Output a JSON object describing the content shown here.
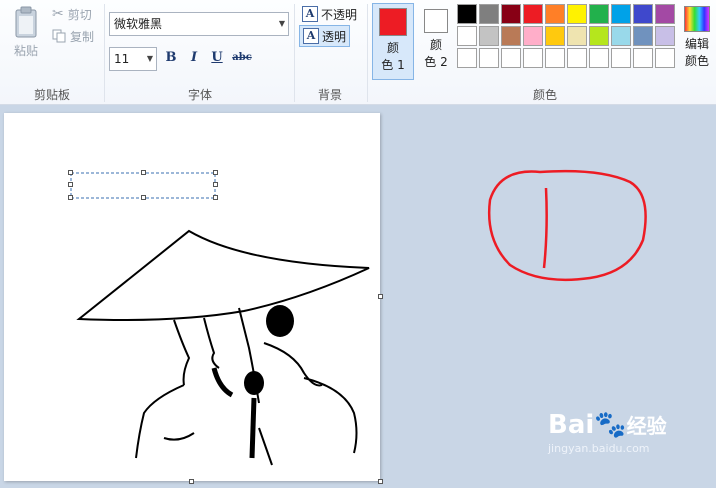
{
  "clipboard": {
    "paste_label": "粘贴",
    "cut_label": "剪切",
    "copy_label": "复制",
    "group_label": "剪贴板"
  },
  "font": {
    "family_value": "微软雅黑",
    "size_value": "11",
    "bold_label": "B",
    "italic_label": "I",
    "underline_label": "U",
    "strike_label": "abc",
    "group_label": "字体"
  },
  "background": {
    "opaque_label": "不透明",
    "transparent_label": "透明",
    "group_label": "背景",
    "icon_letter": "A"
  },
  "colors": {
    "color1_label_line1": "颜",
    "color1_label_line2": "色 1",
    "color2_label_line1": "颜",
    "color2_label_line2": "色 2",
    "color1_value": "#ed1c24",
    "color2_value": "#ffffff",
    "edit_label_line1": "编辑",
    "edit_label_line2": "颜色",
    "group_label": "颜色",
    "palette": [
      "#000000",
      "#7f7f7f",
      "#880015",
      "#ed1c24",
      "#ff7f27",
      "#fff200",
      "#22b14c",
      "#00a2e8",
      "#3f48cc",
      "#a349a4",
      "#ffffff",
      "#c3c3c3",
      "#b97a57",
      "#ffaec9",
      "#ffc90e",
      "#efe4b0",
      "#b5e61d",
      "#99d9ea",
      "#7092be",
      "#c8bfe7",
      "#ffffff",
      "#ffffff",
      "#ffffff",
      "#ffffff",
      "#ffffff",
      "#ffffff",
      "#ffffff",
      "#ffffff",
      "#ffffff",
      "#ffffff"
    ]
  },
  "watermark": {
    "brand": "Bai",
    "brand_suffix": "经验",
    "url": "jingyan.baidu.com"
  },
  "sketch_stroke_color": "#ed1c24"
}
